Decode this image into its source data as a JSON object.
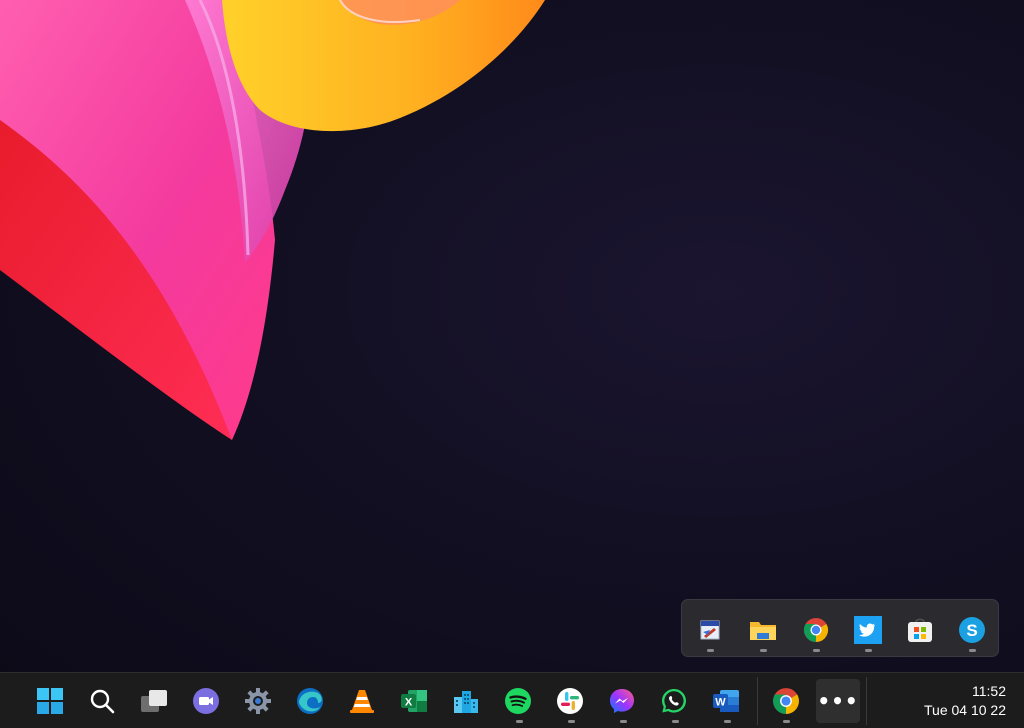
{
  "wallpaper": {
    "name": "bloom-wallpaper"
  },
  "overflow_flyout": {
    "apps": [
      {
        "name": "paint-app"
      },
      {
        "name": "file-explorer"
      },
      {
        "name": "chrome"
      },
      {
        "name": "twitter"
      },
      {
        "name": "microsoft-store"
      },
      {
        "name": "skype"
      }
    ]
  },
  "taskbar": {
    "apps": [
      {
        "name": "start"
      },
      {
        "name": "search"
      },
      {
        "name": "task-view"
      },
      {
        "name": "teams-chat"
      },
      {
        "name": "settings"
      },
      {
        "name": "edge"
      },
      {
        "name": "vlc"
      },
      {
        "name": "excel"
      },
      {
        "name": "city-app"
      },
      {
        "name": "spotify"
      },
      {
        "name": "slack"
      },
      {
        "name": "messenger"
      },
      {
        "name": "whatsapp"
      },
      {
        "name": "word"
      },
      {
        "name": "chrome"
      },
      {
        "name": "overflow-more"
      }
    ],
    "more_label": "•••",
    "clock": {
      "time": "11:52",
      "date": "Tue 04 10 22"
    }
  },
  "colors": {
    "taskbar_bg": "#1c1c1c",
    "flyout_bg": "#2b2b2f",
    "running_indicator": "#8a8a8a"
  }
}
